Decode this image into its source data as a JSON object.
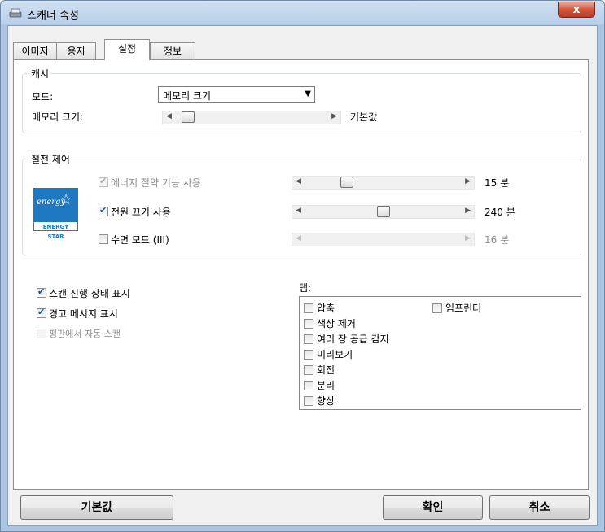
{
  "window": {
    "title": "스캐너 속성",
    "close_label": "x"
  },
  "tabs": [
    {
      "label": "이미지"
    },
    {
      "label": "용지"
    },
    {
      "label": "설정"
    },
    {
      "label": "정보"
    }
  ],
  "cache": {
    "group_title": "캐시",
    "mode_label": "모드:",
    "mode_value": "메모리 크기",
    "memory_label": "메모리 크기:",
    "memory_value": "기본값",
    "memory_slider_level": 0.05
  },
  "power": {
    "group_title": "절전 제어",
    "logo_script": "energy",
    "logo_band": "ENERGY STAR",
    "rows": [
      {
        "label": "에너지 절약 기능 사용",
        "checked": true,
        "enabled": false,
        "value": "15 분",
        "slider_level": 0.25
      },
      {
        "label": "전원 끄기 사용",
        "checked": true,
        "enabled": true,
        "value": "240 분",
        "slider_level": 0.5
      },
      {
        "label": "수면 모드 (III)",
        "checked": false,
        "enabled": true,
        "value": "16 분",
        "slider_enabled": false,
        "slider_level": 0.0
      }
    ]
  },
  "options": [
    {
      "label": "스캔 진행 상태 표시",
      "checked": true,
      "enabled": true
    },
    {
      "label": "경고 메시지 표시",
      "checked": true,
      "enabled": true
    },
    {
      "label": "평판에서 자동 스캔",
      "checked": false,
      "enabled": false
    }
  ],
  "tab_list": {
    "label": "탭:",
    "items": [
      {
        "label": "압축",
        "checked": false
      },
      {
        "label": "색상 제거",
        "checked": false
      },
      {
        "label": "여러 장 공급 감지",
        "checked": false
      },
      {
        "label": "미리보기",
        "checked": false
      },
      {
        "label": "회전",
        "checked": false
      },
      {
        "label": "분리",
        "checked": false
      },
      {
        "label": "향상",
        "checked": false
      },
      {
        "label": "임프린터",
        "checked": false
      }
    ]
  },
  "buttons": {
    "default": "기본값",
    "ok": "확인",
    "cancel": "취소"
  }
}
